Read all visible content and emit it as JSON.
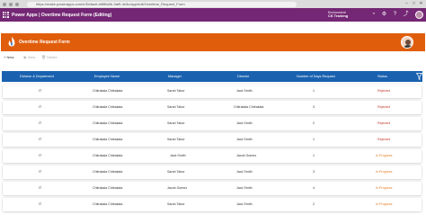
{
  "browser": {
    "url": "https://make.powerapps.com/e/Default-b6f8fa0b-3af9-4e3c/app/edit/Overtime_Request_Form"
  },
  "app_bar": {
    "title": "Power Apps  |  Overtime Request Form (Editing)",
    "environment_label": "Environment",
    "environment_name": "CS Training"
  },
  "header": {
    "title": "Overtime Request Form"
  },
  "command_bar": {
    "new_label": "New",
    "view_label": "View",
    "delete_label": "Delete"
  },
  "table": {
    "columns": [
      "Division & Department",
      "Employee Name",
      "Manager",
      "Director",
      "Number of Days Request",
      "Status"
    ],
    "rows": [
      {
        "division": "IT",
        "employee": "Chitrakala Chitrakala",
        "manager": "Sarah Tabor",
        "director": "Jack Smith",
        "days": "1",
        "status": "Rejected"
      },
      {
        "division": "IT",
        "employee": "Chitrakala Chitrakala",
        "manager": "Sarah Tabor",
        "director": "Chitrakala Chitrakala",
        "days": "3",
        "status": "Rejected"
      },
      {
        "division": "IT",
        "employee": "Chitrakala Chitrakala",
        "manager": "Sarah Tabor",
        "director": "Jack Smith",
        "days": "2",
        "status": "Rejected"
      },
      {
        "division": "IT",
        "employee": "Chitrakala Chitrakala",
        "manager": "Sarah Tabor",
        "director": "Jack Smith",
        "days": "1",
        "status": "Rejected"
      },
      {
        "division": "IT",
        "employee": "Chitrakala Chitrakala",
        "manager": "Jack Smith",
        "director": "Jacob Gomez",
        "days": "1",
        "status": "In Progress"
      },
      {
        "division": "IT",
        "employee": "Chitrakala Chitrakala",
        "manager": "Sarah Tabor",
        "director": "Jack Smith",
        "days": "3",
        "status": "In Progress"
      },
      {
        "division": "IT",
        "employee": "Chitrakala Chitrakala",
        "manager": "Jacob Gomez",
        "director": "Jack Smith",
        "days": "4",
        "status": "In Progress"
      },
      {
        "division": "IT",
        "employee": "Chitrakala Chitrakala",
        "manager": "Sarah Tabor",
        "director": "Jack Smith",
        "days": "2",
        "status": "In Progress"
      }
    ]
  },
  "colors": {
    "app_bar": "#742774",
    "header": "#e05e0b",
    "table_header": "#1a62b0",
    "rejected": "#c0392b",
    "in_progress": "#e67e22"
  }
}
